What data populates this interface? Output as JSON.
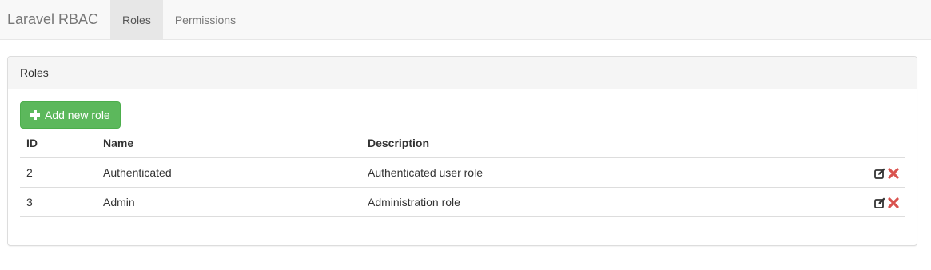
{
  "navbar": {
    "brand": "Laravel RBAC",
    "items": [
      {
        "label": "Roles",
        "active": true
      },
      {
        "label": "Permissions",
        "active": false
      }
    ]
  },
  "panel": {
    "title": "Roles",
    "add_button_label": "Add new role",
    "add_button_icon": "plus-icon"
  },
  "table": {
    "headers": [
      "ID",
      "Name",
      "Description",
      ""
    ],
    "rows": [
      {
        "id": "2",
        "name": "Authenticated",
        "description": "Authenticated user role"
      },
      {
        "id": "3",
        "name": "Admin",
        "description": "Administration role"
      }
    ],
    "row_actions": [
      {
        "icon": "edit-icon",
        "color": "#333333"
      },
      {
        "icon": "delete-icon",
        "color": "#d9534f"
      }
    ]
  },
  "colors": {
    "navbar_bg": "#f8f8f8",
    "active_tab_bg": "#e7e7e7",
    "button_green": "#5cb85c",
    "delete_red": "#d9534f"
  }
}
